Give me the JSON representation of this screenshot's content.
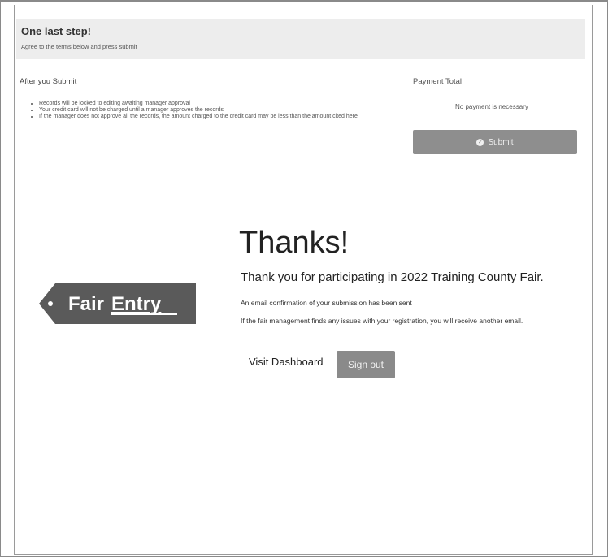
{
  "step": {
    "title": "One last step!",
    "subtitle": "Agree to the terms below and press submit"
  },
  "after_submit": {
    "heading": "After you Submit",
    "items": [
      "Records will be locked to editing awaiting manager approval",
      "Your credit card will not be charged until a manager approves the records",
      "If the manager does not approve all the records, the amount charged to the credit card may be less than the amount cited here"
    ]
  },
  "payment": {
    "heading": "Payment Total",
    "note": "No payment is necessary",
    "submit_label": "Submit",
    "submit_icon": "check-circle-icon"
  },
  "logo": {
    "text_fair": "Fair",
    "text_entry": "Entry"
  },
  "thanks": {
    "title": "Thanks!",
    "subtitle": "Thank you for participating in 2022 Training County Fair.",
    "email_line": "An email confirmation of your submission has been sent",
    "issue_line": "If the fair management finds any issues with your registration, you will receive another email."
  },
  "actions": {
    "dashboard_label": "Visit Dashboard",
    "signout_label": "Sign out"
  },
  "colors": {
    "banner_bg": "#ededed",
    "button_bg": "#8e8e8e",
    "logo_bg": "#5a5a5a"
  }
}
